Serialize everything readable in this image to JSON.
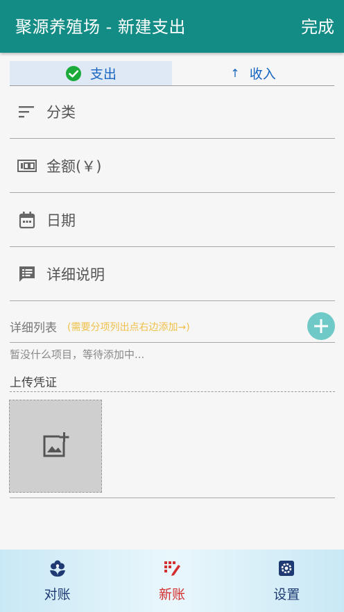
{
  "appbar": {
    "title": "聚源养殖场 - 新建支出",
    "done_label": "完成"
  },
  "tabs": [
    {
      "label": "支出",
      "active": true,
      "icon": "check-circle-icon"
    },
    {
      "label": "收入",
      "active": false,
      "icon": "arrow-up-icon"
    }
  ],
  "fields": {
    "category": {
      "label": "分类",
      "icon": "sort-lines-icon"
    },
    "amount": {
      "label": "金额(￥)",
      "icon": "money-icon"
    },
    "date": {
      "label": "日期",
      "icon": "calendar-icon"
    },
    "description": {
      "label": "详细说明",
      "icon": "comment-icon"
    }
  },
  "details": {
    "title": "详细列表",
    "hint": "(需要分项列出点右边添加→)",
    "empty_text": "暂没什么项目，等待添加中..."
  },
  "upload": {
    "title": "上传凭证",
    "icon": "add-photo-icon"
  },
  "bottom_nav": [
    {
      "label": "对账",
      "icon": "flower-icon",
      "active": false
    },
    {
      "label": "新账",
      "icon": "apps-icon",
      "active": true
    },
    {
      "label": "设置",
      "icon": "settings-icon",
      "active": false
    }
  ],
  "colors": {
    "primary": "#138c85",
    "tab_text": "#1565c0",
    "check_green": "#1aaa3a",
    "hint_yellow": "#f0c04a",
    "nav_active": "#d32f2f",
    "nav_inactive": "#1f3a73",
    "add_button": "#6fc9c6"
  }
}
